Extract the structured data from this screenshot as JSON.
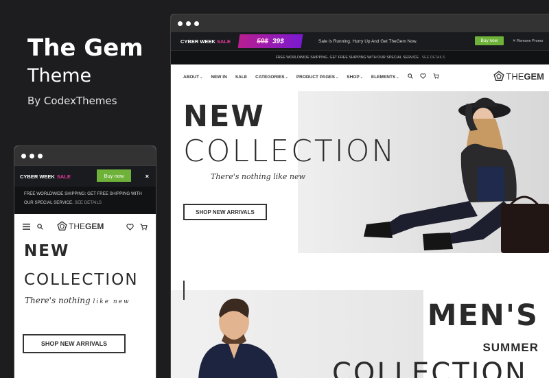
{
  "brand": {
    "title": "The Gem",
    "subtitle": "Theme",
    "byline": "By CodexThemes"
  },
  "desktop": {
    "promo": {
      "cyber": "CYBER WEEK",
      "sale": "SALE",
      "old_price": "59$",
      "new_price": "39$",
      "message": "Sale Is Running. Hurry Up And Get TheGem Now.",
      "buy_label": "Buy now",
      "remove_label": "Remove Promo"
    },
    "shipping": {
      "text": "FREE WORLDWIDE SHIPPING. GET FREE SHIPPING WITH OUR SPECIAL SERVICE.",
      "details": "SEE DETAILS"
    },
    "nav": {
      "items": [
        "ABOUT",
        "NEW IN",
        "SALE",
        "CATEGORIES",
        "PRODUCT PAGES",
        "SHOP",
        "ELEMENTS"
      ],
      "icons": [
        "search-icon",
        "heart-icon",
        "cart-icon"
      ]
    },
    "logo": {
      "the": "THE",
      "gem": "GEM"
    },
    "hero": {
      "line1": "NEW",
      "line2": "COLLECTION",
      "tagline": "There's nothing like new",
      "button": "SHOP NEW ARRIVALS"
    },
    "mens": {
      "line1": "MEN'S",
      "line2": "SUMMER",
      "line3": "COLLECTION"
    }
  },
  "mobile": {
    "promo": {
      "cyber": "CYBER WEEK",
      "sale": "SALE",
      "buy_label": "Buy now",
      "close": "×"
    },
    "shipping": {
      "line1": "FREE WORLDWIDE SHIPPING: GET FREE SHIPPING WITH",
      "line2": "OUR SPECIAL SERVICE.",
      "details": "SEE DETAILS"
    },
    "logo": {
      "the": "THE",
      "gem": "GEM"
    },
    "hero": {
      "line1": "NEW",
      "line2": "COLLECTION",
      "tagline_a": "There's nothing",
      "tagline_b": "like new",
      "button": "SHOP NEW ARRIVALS"
    }
  },
  "colors": {
    "accent_sale": "#e23b9a",
    "buy_button": "#6fb23a",
    "background": "#1d1d1f"
  }
}
